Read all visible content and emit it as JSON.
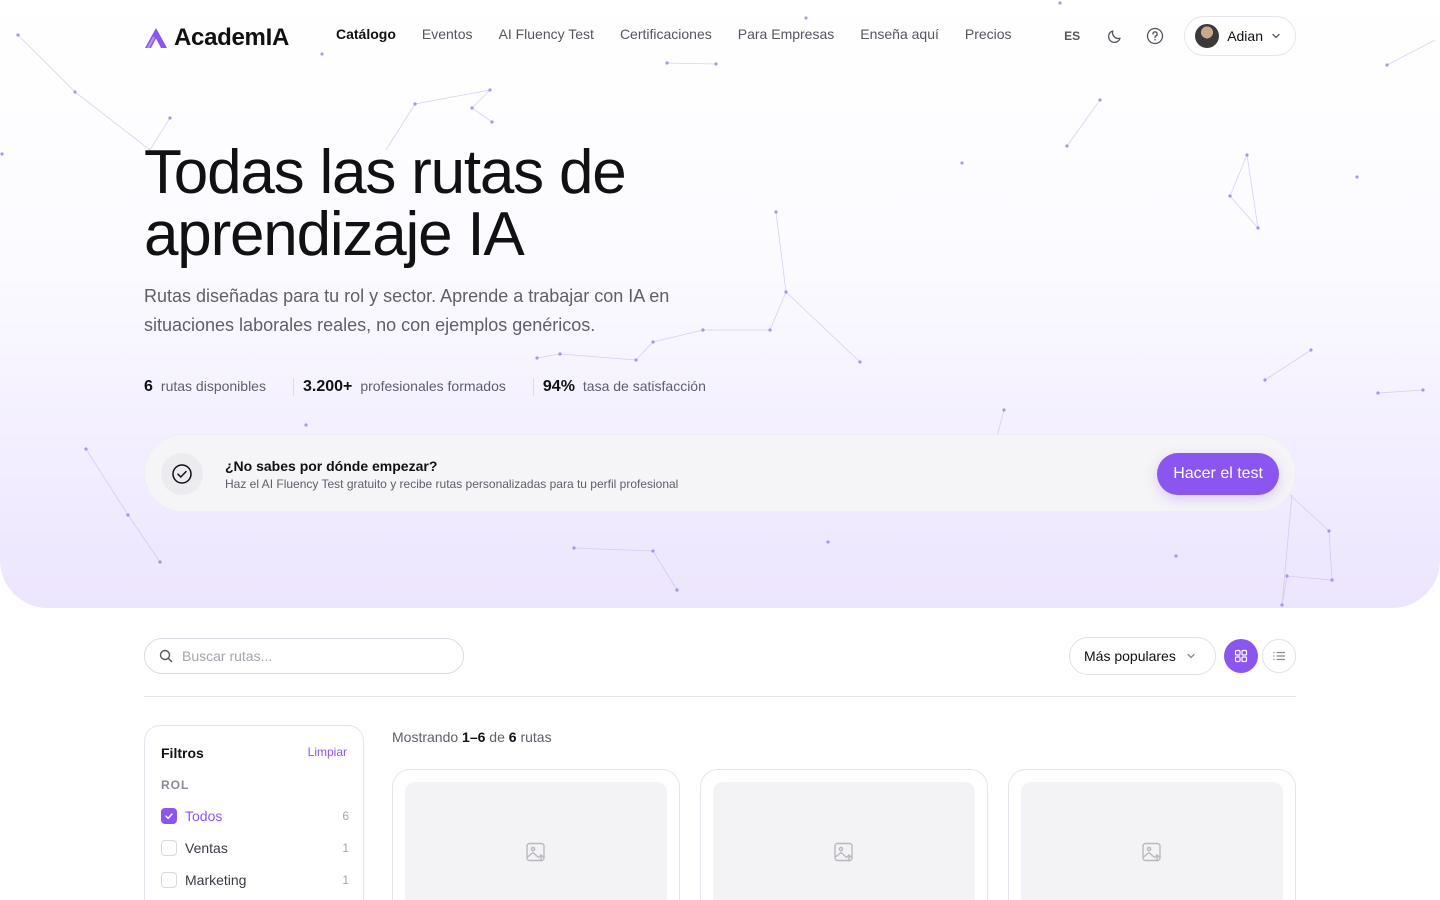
{
  "brand": {
    "name": "AcademIA",
    "accent": "#8b55f0"
  },
  "nav": {
    "links": [
      {
        "label": "Catálogo",
        "active": true
      },
      {
        "label": "Eventos"
      },
      {
        "label": "AI Fluency Test"
      },
      {
        "label": "Certificaciones"
      },
      {
        "label": "Para Empresas"
      },
      {
        "label": "Enseña aquí"
      },
      {
        "label": "Precios"
      }
    ],
    "language": "ES",
    "theme_icon": "moon-icon",
    "help_icon": "help-circle-icon",
    "user": {
      "name": "Adian"
    }
  },
  "hero": {
    "title": "Todas las rutas de aprendizaje IA",
    "subtitle": "Rutas diseñadas para tu rol y sector. Aprende a trabajar con IA en situaciones laborales reales, no con ejemplos genéricos.",
    "stats": [
      {
        "value": "6",
        "label": "rutas disponibles"
      },
      {
        "value": "3.200+",
        "label": "profesionales formados"
      },
      {
        "value": "94%",
        "label": "tasa de satisfacción"
      }
    ],
    "cta": {
      "title": "¿No sabes por dónde empezar?",
      "text": "Haz el AI Fluency Test gratuito y recibe rutas personalizadas para tu perfil profesional",
      "button": "Hacer el test"
    }
  },
  "toolbar": {
    "search_placeholder": "Buscar rutas...",
    "sort_label": "Más populares",
    "view_mode": "grid"
  },
  "filters": {
    "title": "Filtros",
    "clear": "Limpiar",
    "section": "ROL",
    "items": [
      {
        "label": "Todos",
        "count": "6",
        "checked": true
      },
      {
        "label": "Ventas",
        "count": "1",
        "checked": false
      },
      {
        "label": "Marketing",
        "count": "1",
        "checked": false
      }
    ]
  },
  "results": {
    "prefix": "Mostrando",
    "range": "1–6",
    "of": "de",
    "total": "6",
    "suffix": "rutas",
    "cards": [
      {
        "image_icon": "image-placeholder-icon"
      },
      {
        "image_icon": "image-placeholder-icon"
      },
      {
        "image_icon": "image-placeholder-icon"
      }
    ]
  }
}
